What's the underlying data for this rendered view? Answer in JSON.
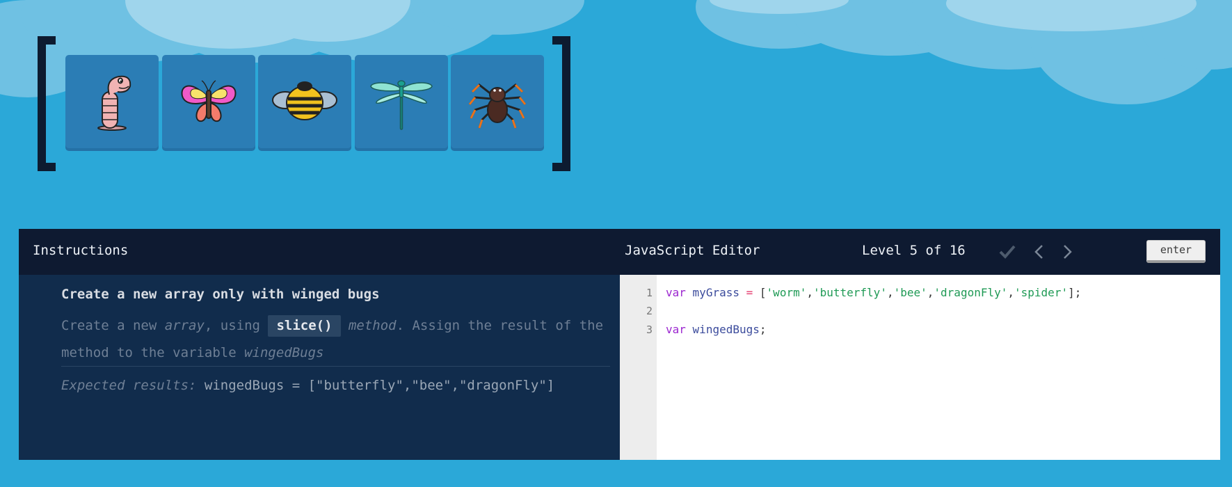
{
  "bugs": [
    {
      "name": "worm",
      "icon": "worm-icon"
    },
    {
      "name": "butterfly",
      "icon": "butterfly-icon"
    },
    {
      "name": "bee",
      "icon": "bee-icon"
    },
    {
      "name": "dragonFly",
      "icon": "dragonfly-icon"
    },
    {
      "name": "spider",
      "icon": "spider-icon"
    }
  ],
  "header": {
    "instructions_title": "Instructions",
    "editor_title": "JavaScript Editor",
    "level_text": "Level 5 of 16",
    "enter_label": "enter"
  },
  "instructions": {
    "title": "Create a new array only with winged bugs",
    "body_1": "Create a new ",
    "body_array": "array",
    "body_2": ", using ",
    "body_code": "slice()",
    "body_3": " ",
    "body_method": "method",
    "body_4": ". Assign the result of the method to the variable ",
    "body_var": "wingedBugs",
    "expected_label": "Expected results:",
    "expected_value": " wingedBugs = [\"butterfly\",\"bee\",\"dragonFly\"]"
  },
  "editor": {
    "line_numbers": [
      "1",
      "2",
      "3"
    ],
    "line1": {
      "kw": "var",
      "var": "myGrass",
      "op": "=",
      "open": "[",
      "s1": "'worm'",
      "s2": "'butterfly'",
      "s3": "'bee'",
      "s4": "'dragonFly'",
      "s5": "'spider'",
      "close": "];",
      "comma": ","
    },
    "line3": {
      "kw": "var",
      "var": "wingedBugs",
      "end": ";"
    }
  },
  "colors": {
    "sky": "#2ba8d8",
    "header_bg": "#0e1a31",
    "instructions_bg": "#112c4c",
    "tile": "#2b7db5"
  }
}
